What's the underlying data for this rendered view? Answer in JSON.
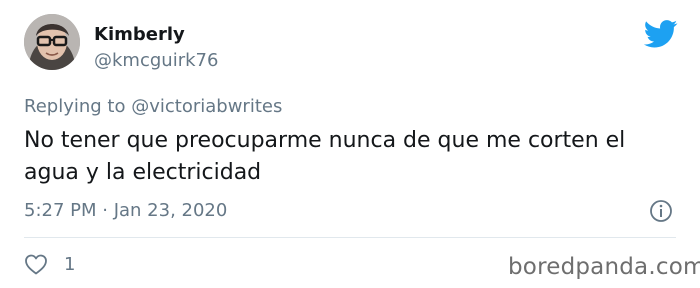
{
  "tweet": {
    "author": {
      "display_name": "Kimberly",
      "handle": "@kmcguirk76"
    },
    "reply_prefix": "Replying to",
    "reply_to": "@victoriabwrites",
    "text": "No tener que preocuparme nunca de que me corten el agua y la electricidad",
    "timestamp": "5:27 PM · Jan 23, 2020",
    "like_count": "1"
  },
  "icons": {
    "brand": "twitter-bird-icon",
    "info": "info-icon",
    "like": "heart-icon"
  },
  "colors": {
    "brand_blue": "#1da1f2",
    "secondary_text": "#657786",
    "divider": "#e1e8ed"
  },
  "watermark": "boredpanda.com"
}
